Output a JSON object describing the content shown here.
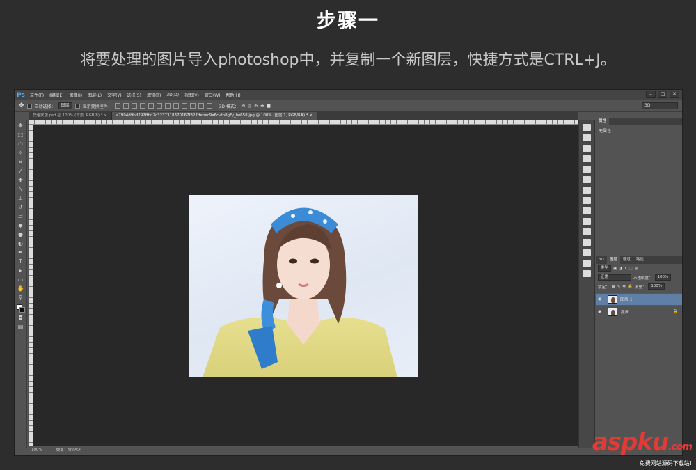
{
  "title": "步骤一",
  "subtitle": "将要处理的图片导入photoshop中，并复制一个新图层，快捷方式是CTRL+J。",
  "app": {
    "logo": "Ps",
    "menu": [
      "文件(F)",
      "编辑(E)",
      "图像(I)",
      "图层(L)",
      "文字(Y)",
      "选择(S)",
      "滤镜(T)",
      "3D(D)",
      "视图(V)",
      "窗口(W)",
      "帮助(H)"
    ],
    "window_controls": [
      "–",
      "□",
      "✕"
    ]
  },
  "options_bar": {
    "tool_icon": "move-tool-icon",
    "auto_select_label": "自动选择：",
    "auto_select_value": "图层",
    "show_transform_label": "显示变换控件",
    "mode_3d_label": "3D 模式：",
    "workspace_value": "3D"
  },
  "tabs": [
    {
      "label": "快速蒙版.psd @ 100% (背景, RGB/8) *  ×",
      "active": false
    },
    {
      "label": "a7994d9bd292ffbd2c3237318370167f327debec9a6c-db8gFy_fw658.jpg @ 100% (图层 1, RGB/8#) *  ×",
      "active": true
    }
  ],
  "status": {
    "zoom": "100%",
    "efficiency": "效率：100%*"
  },
  "properties_panel": {
    "tab": "属性",
    "content": "无属性"
  },
  "layers_panel": {
    "tabs": [
      "3D",
      "图层",
      "通道",
      "路径"
    ],
    "active_tab": "图层",
    "filter_label": "类型",
    "blend_mode": "正常",
    "opacity_label": "不透明度：",
    "opacity_value": "100%",
    "lock_label": "锁定：",
    "fill_label": "填充：",
    "fill_value": "100%",
    "layers": [
      {
        "name": "图层 1",
        "selected": true,
        "locked": false
      },
      {
        "name": "背景",
        "selected": false,
        "locked": true
      }
    ]
  },
  "watermark": {
    "logo": "aspku",
    "tld": ".com",
    "tagline": "免费网站源码下载站!"
  }
}
